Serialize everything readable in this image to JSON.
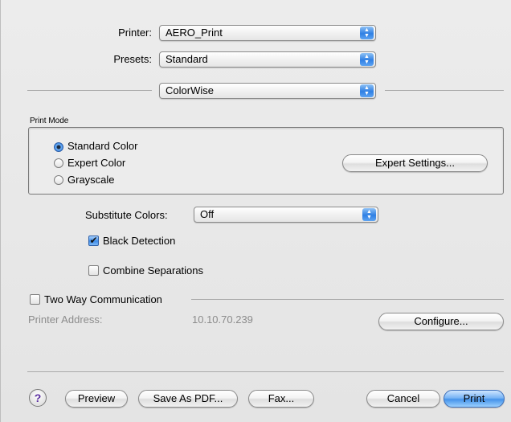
{
  "printer": {
    "label": "Printer:",
    "value": "AERO_Print"
  },
  "presets": {
    "label": "Presets:",
    "value": "Standard"
  },
  "panel": {
    "value": "ColorWise"
  },
  "print_mode": {
    "title": "Print Mode",
    "options": [
      "Standard Color",
      "Expert Color",
      "Grayscale"
    ],
    "selected": "Standard Color",
    "expert_button": "Expert Settings..."
  },
  "substitute": {
    "label": "Substitute Colors:",
    "value": "Off"
  },
  "black_detection": {
    "label": "Black Detection",
    "checked": true
  },
  "combine_separations": {
    "label": "Combine Separations",
    "checked": false
  },
  "two_way": {
    "label": "Two Way Communication",
    "checked": false
  },
  "printer_address": {
    "label": "Printer Address:",
    "value": "10.10.70.239",
    "configure_button": "Configure..."
  },
  "footer": {
    "help": "?",
    "preview": "Preview",
    "save_pdf": "Save As PDF...",
    "fax": "Fax...",
    "cancel": "Cancel",
    "print": "Print"
  },
  "colors": {
    "accent": "#2f7fe4",
    "disabled_text": "#8c8c8c"
  }
}
